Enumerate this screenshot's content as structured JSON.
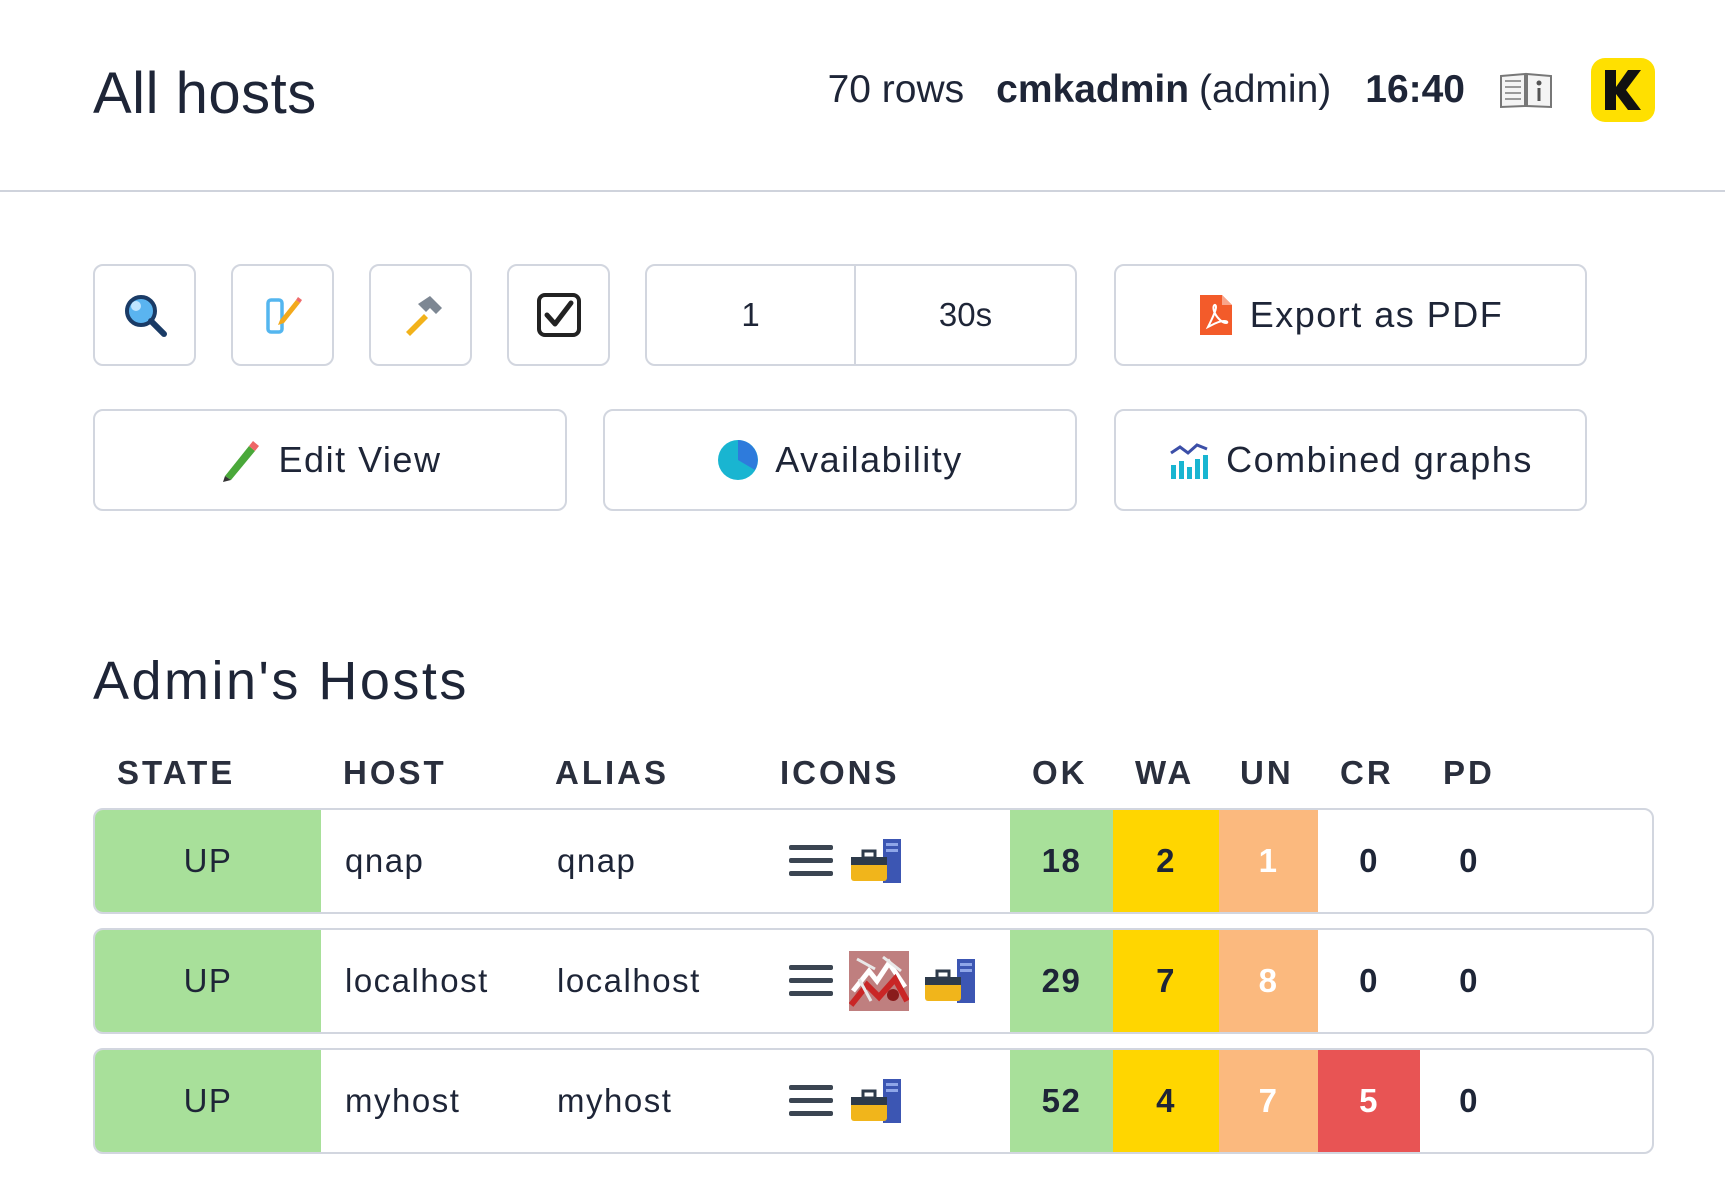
{
  "header": {
    "title": "All hosts",
    "rows": "70 rows",
    "user": "cmkadmin",
    "role": "(admin)",
    "time": "16:40",
    "help_icon": "book-info-icon",
    "logo_icon": "checkmk-logo"
  },
  "toolbar": {
    "square_buttons": [
      {
        "icon": "search-icon"
      },
      {
        "icon": "display-options-icon"
      },
      {
        "icon": "commands-hammer-icon"
      },
      {
        "icon": "checkbox-icon"
      }
    ],
    "refresh": {
      "page": "1",
      "interval": "30s"
    },
    "export_pdf": "Export as PDF",
    "edit_view": "Edit View",
    "availability": "Availability",
    "combined_graphs": "Combined graphs"
  },
  "section": {
    "title": "Admin's Hosts"
  },
  "table": {
    "columns": [
      "STATE",
      "HOST",
      "ALIAS",
      "ICONS",
      "OK",
      "WA",
      "UN",
      "CR",
      "PD"
    ],
    "rows": [
      {
        "state": "UP",
        "host": "qnap",
        "alias": "qnap",
        "icons": [
          "menu-icon",
          "wato-folder-icon"
        ],
        "ok": "18",
        "wa": "2",
        "un": "1",
        "cr": "0",
        "pd": "0"
      },
      {
        "state": "UP",
        "host": "localhost",
        "alias": "localhost",
        "icons": [
          "menu-icon",
          "host-image-icon",
          "wato-folder-icon"
        ],
        "ok": "29",
        "wa": "7",
        "un": "8",
        "cr": "0",
        "pd": "0"
      },
      {
        "state": "UP",
        "host": "myhost",
        "alias": "myhost",
        "icons": [
          "menu-icon",
          "wato-folder-icon"
        ],
        "ok": "52",
        "wa": "4",
        "un": "7",
        "cr": "5",
        "pd": "0"
      }
    ]
  },
  "colors": {
    "ok": "#a8e09a",
    "warn": "#ffd600",
    "unknown": "#fbb97e",
    "crit": "#e85454",
    "logo": "#ffe000"
  }
}
